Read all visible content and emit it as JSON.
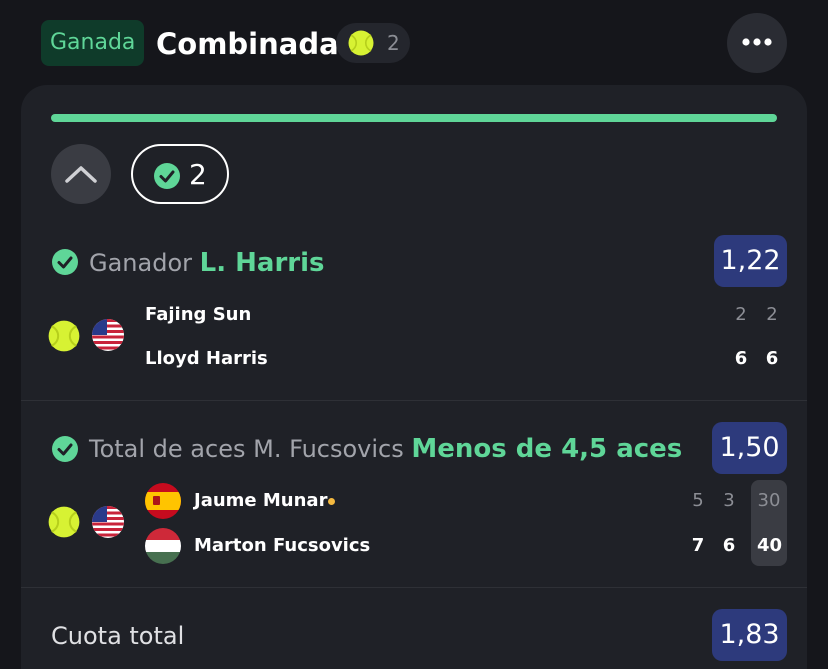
{
  "header": {
    "status_badge": "Ganada",
    "title": "Combinada",
    "count": "2",
    "more_icon": "more-horizontal-icon"
  },
  "card": {
    "progress_color": "#5fd698",
    "won_count": "2",
    "selections": [
      {
        "market": "Ganador",
        "pick": "L. Harris",
        "odds": "1,22",
        "players": [
          {
            "name": "Fajing Sun",
            "scores": [
              "2",
              "2"
            ],
            "flag": "us-flag-icon"
          },
          {
            "name": "Lloyd Harris",
            "scores": [
              "6",
              "6"
            ]
          }
        ]
      },
      {
        "market": "Total de aces M. Fucsovics",
        "pick": "Menos de 4,5 aces",
        "odds": "1,50",
        "players": [
          {
            "name": "Jaume Munar",
            "scores": [
              "5",
              "3"
            ],
            "points": "30",
            "flag": "es-flag-icon",
            "serving": true
          },
          {
            "name": "Marton Fucsovics",
            "scores": [
              "7",
              "6"
            ],
            "points": "40",
            "flag": "hu-flag-icon"
          }
        ]
      }
    ],
    "total": {
      "label": "Cuota total",
      "odds": "1,83"
    }
  },
  "colors": {
    "accent": "#5fd698",
    "odds_bg": "#2d3a7c",
    "background": "#15161b"
  }
}
